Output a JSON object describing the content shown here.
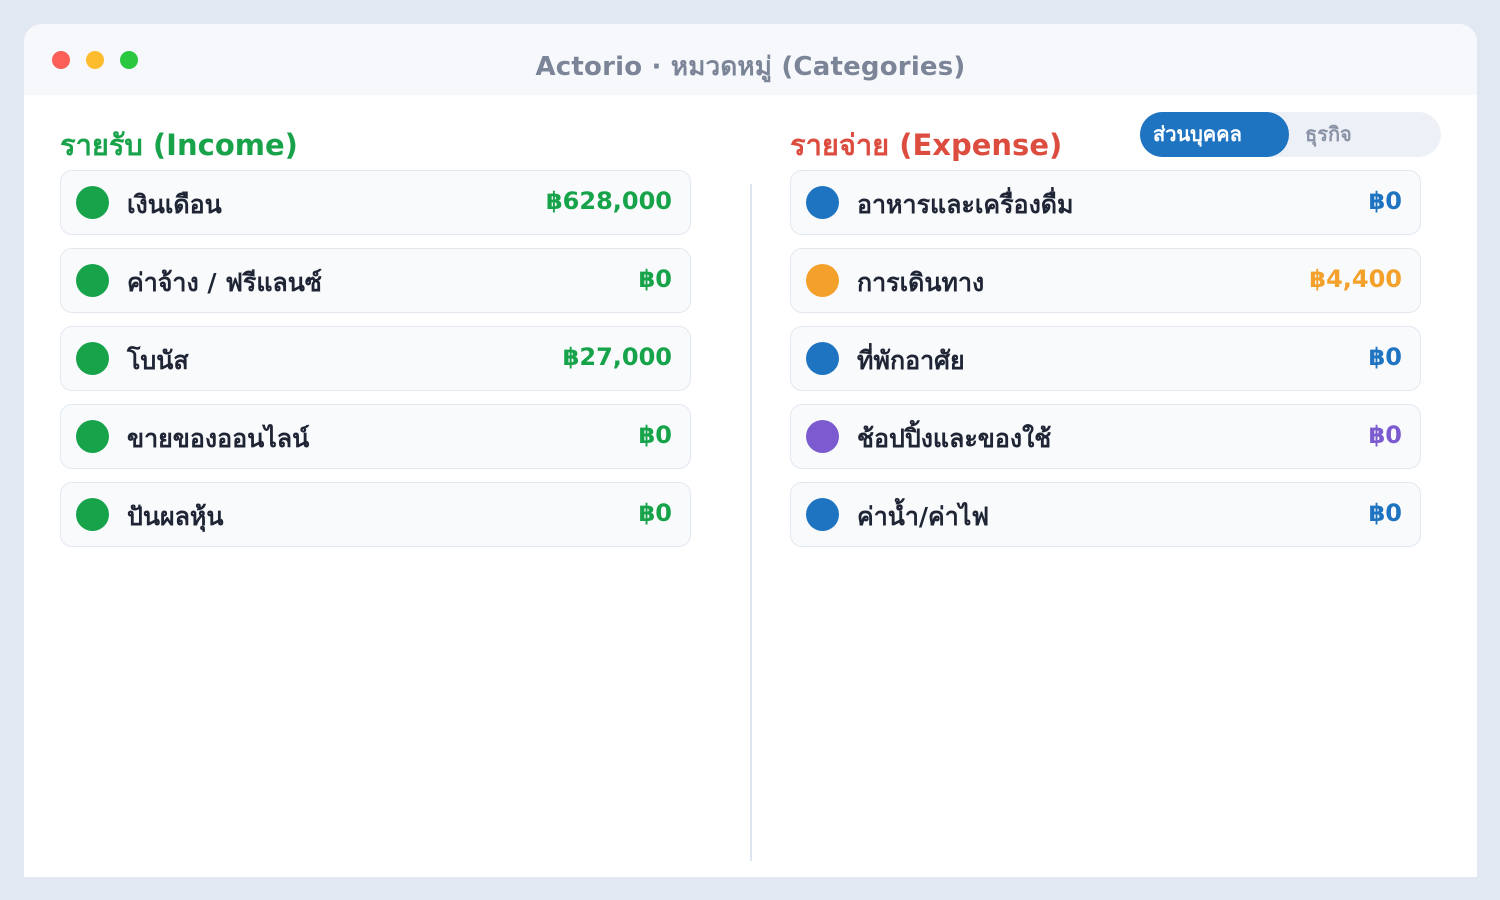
{
  "window": {
    "title": "Actorio · หมวดหมู่ (Categories)",
    "controls": [
      {
        "name": "close",
        "color": "#fb5f57"
      },
      {
        "name": "minimize",
        "color": "#fdbc2e"
      },
      {
        "name": "maximize",
        "color": "#2ac83f"
      }
    ]
  },
  "colors": {
    "income_accent": "#18a34a",
    "expense_accent": "#dc4c3f",
    "toggle_active": "#1f74c2"
  },
  "income": {
    "title": "รายรับ (Income)",
    "items": [
      {
        "name": "เงินเดือน",
        "amount": "฿628,000",
        "color": "#16a34a"
      },
      {
        "name": "ค่าจ้าง / ฟรีแลนซ์",
        "amount": "฿0",
        "color": "#16a34a"
      },
      {
        "name": "โบนัส",
        "amount": "฿27,000",
        "color": "#16a34a"
      },
      {
        "name": "ขายของออนไลน์",
        "amount": "฿0",
        "color": "#16a34a"
      },
      {
        "name": "ปันผลหุ้น",
        "amount": "฿0",
        "color": "#16a34a"
      }
    ]
  },
  "expense": {
    "title": "รายจ่าย (Expense)",
    "toggle": {
      "options": [
        "ส่วนบุคคล",
        "ธุรกิจ"
      ],
      "selected": "ส่วนบุคคล"
    },
    "items": [
      {
        "name": "อาหารและเครื่องดื่ม",
        "amount": "฿0",
        "color": "#1f74c2"
      },
      {
        "name": "การเดินทาง",
        "amount": "฿4,400",
        "color": "#f4a12c"
      },
      {
        "name": "ที่พักอาศัย",
        "amount": "฿0",
        "color": "#1f74c2"
      },
      {
        "name": "ช้อปปิ้งและของใช้",
        "amount": "฿0",
        "color": "#7b5bcf"
      },
      {
        "name": "ค่าน้ำ/ค่าไฟ",
        "amount": "฿0",
        "color": "#1f74c2"
      }
    ]
  }
}
